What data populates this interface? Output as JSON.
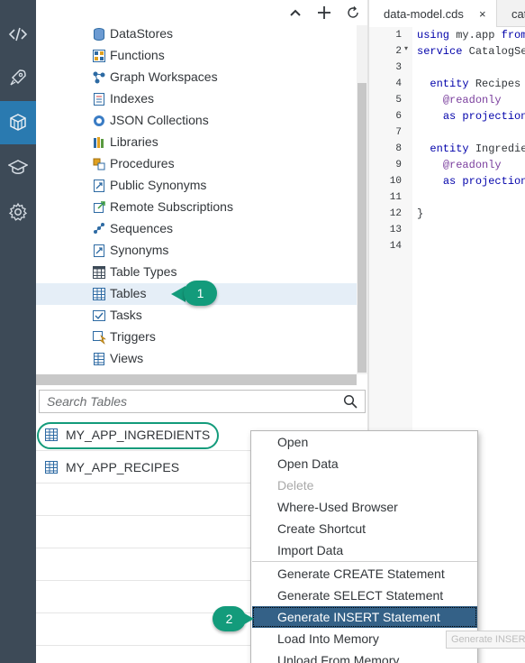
{
  "sidebar": {
    "items": [
      {
        "icon": "code-icon"
      },
      {
        "icon": "rocket-icon"
      },
      {
        "icon": "database-explorer-icon"
      },
      {
        "icon": "learning-icon"
      },
      {
        "icon": "gear-icon"
      }
    ]
  },
  "tree": {
    "toolbar": {
      "collapse_icon": "chevron-up-icon",
      "add_icon": "plus-icon",
      "refresh_icon": "refresh-icon"
    },
    "items": [
      {
        "label": "DataStores",
        "icon": "datastore-icon"
      },
      {
        "label": "Functions",
        "icon": "function-icon"
      },
      {
        "label": "Graph Workspaces",
        "icon": "graph-icon"
      },
      {
        "label": "Indexes",
        "icon": "index-icon"
      },
      {
        "label": "JSON Collections",
        "icon": "json-icon"
      },
      {
        "label": "Libraries",
        "icon": "library-icon"
      },
      {
        "label": "Procedures",
        "icon": "procedure-icon"
      },
      {
        "label": "Public Synonyms",
        "icon": "public-synonym-icon"
      },
      {
        "label": "Remote Subscriptions",
        "icon": "remote-subscription-icon"
      },
      {
        "label": "Sequences",
        "icon": "sequence-icon"
      },
      {
        "label": "Synonyms",
        "icon": "synonym-icon"
      },
      {
        "label": "Table Types",
        "icon": "table-type-icon"
      },
      {
        "label": "Tables",
        "icon": "table-icon"
      },
      {
        "label": "Tasks",
        "icon": "task-icon"
      },
      {
        "label": "Triggers",
        "icon": "trigger-icon"
      },
      {
        "label": "Views",
        "icon": "view-icon"
      }
    ],
    "selected": "Tables"
  },
  "callouts": {
    "first": "1",
    "second": "2"
  },
  "search": {
    "placeholder": "Search Tables"
  },
  "results": [
    {
      "label": "MY_APP_INGREDIENTS"
    },
    {
      "label": "MY_APP_RECIPES"
    }
  ],
  "editor": {
    "tabs": [
      {
        "label": "data-model.cds",
        "close": "×"
      },
      {
        "label": "cat"
      }
    ],
    "lines": [
      {
        "n": "1",
        "code": "using my.app from"
      },
      {
        "n": "2",
        "code": "service CatalogServ"
      },
      {
        "n": "3",
        "code": ""
      },
      {
        "n": "4",
        "code": "  entity Recipes"
      },
      {
        "n": "5",
        "code": "    @readonly"
      },
      {
        "n": "6",
        "code": "    as projection o"
      },
      {
        "n": "7",
        "code": ""
      },
      {
        "n": "8",
        "code": "  entity Ingredient"
      },
      {
        "n": "9",
        "code": "    @readonly"
      },
      {
        "n": "10",
        "code": "    as projection o"
      },
      {
        "n": "11",
        "code": ""
      },
      {
        "n": "12",
        "code": "}"
      },
      {
        "n": "13",
        "code": ""
      },
      {
        "n": "14",
        "code": ""
      }
    ]
  },
  "context_menu": {
    "items": [
      {
        "label": "Open"
      },
      {
        "label": "Open Data"
      },
      {
        "label": "Delete"
      },
      {
        "label": "Where-Used Browser"
      },
      {
        "label": "Create Shortcut"
      },
      {
        "label": "Import Data"
      },
      {
        "label": "Generate CREATE Statement"
      },
      {
        "label": "Generate SELECT Statement"
      },
      {
        "label": "Generate INSERT Statement"
      },
      {
        "label": "Load Into Memory"
      },
      {
        "label": "Unload From Memory"
      }
    ],
    "disabled": [
      "Delete"
    ],
    "highlighted": "Generate INSERT Statement"
  },
  "tooltip": {
    "text": "Generate INSERT Statement"
  },
  "colors": {
    "sidebar": "#3d4a57",
    "sidebar_active": "#2a7ab0",
    "callout": "#139b7b",
    "menu_highlight": "#346187"
  }
}
